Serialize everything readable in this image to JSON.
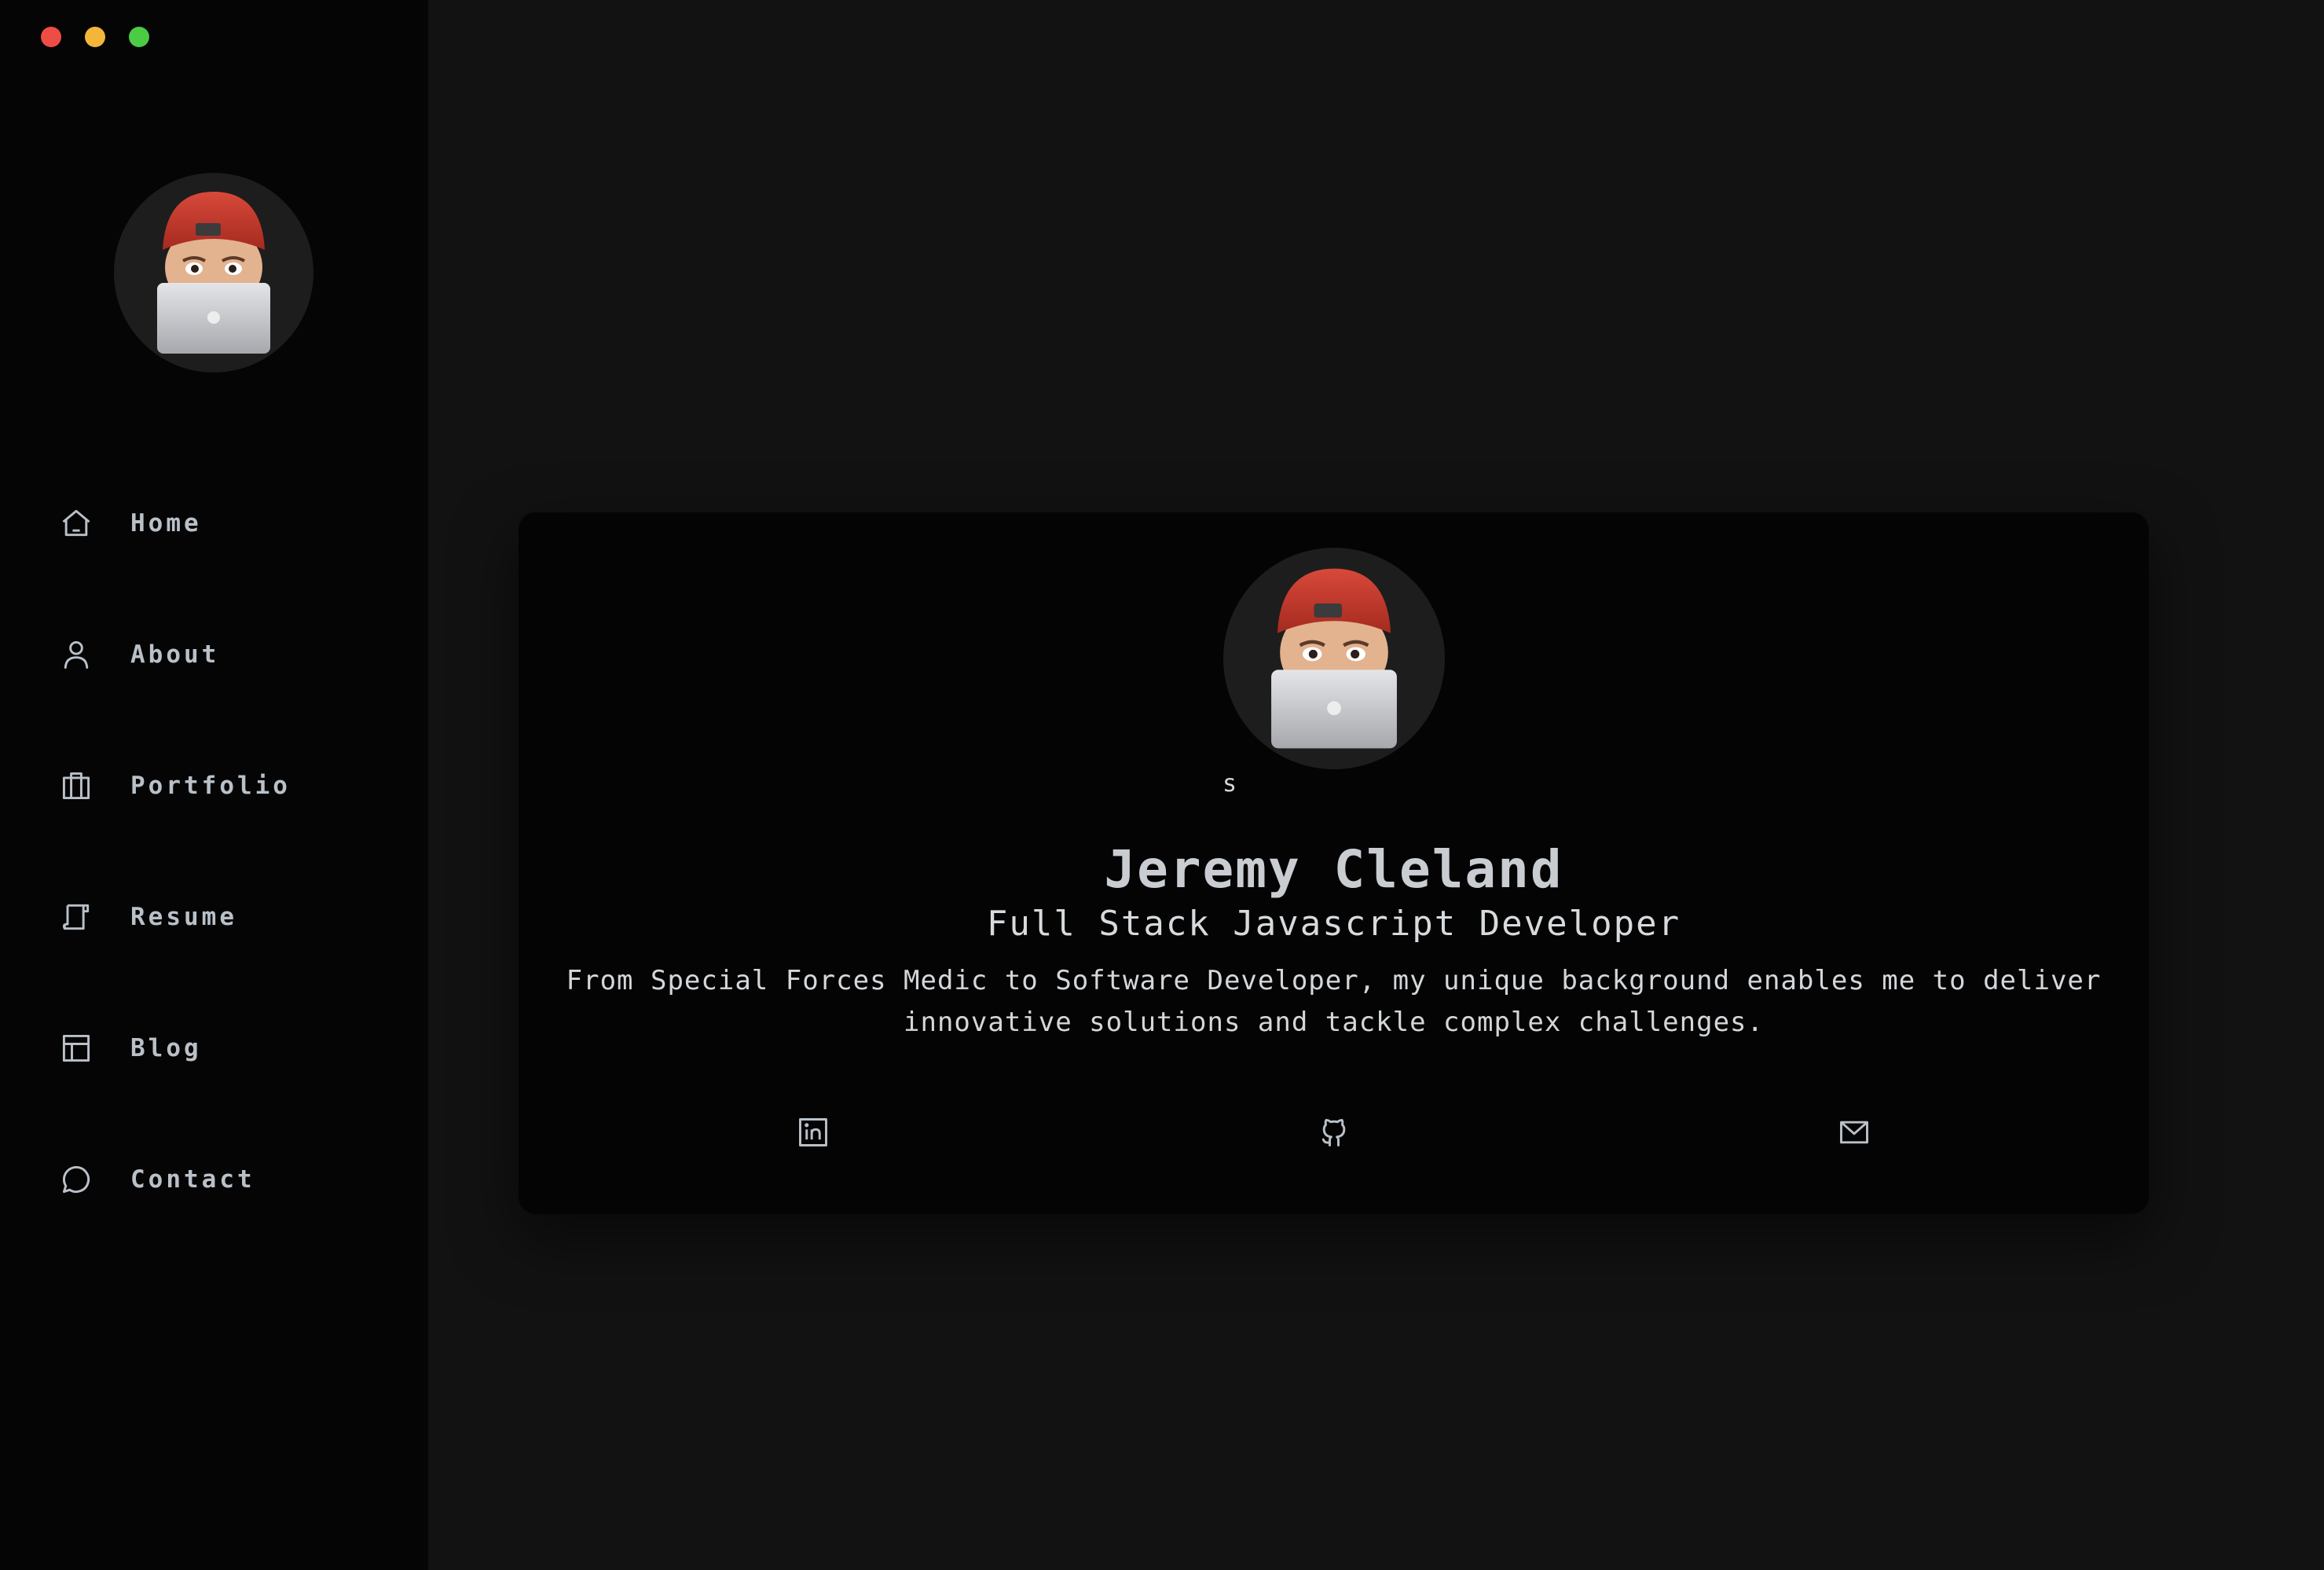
{
  "window": {
    "controls": [
      "close",
      "minimize",
      "maximize"
    ]
  },
  "sidebar": {
    "avatar_icon": "memoji-laptop-avatar",
    "items": [
      {
        "label": "Home",
        "icon": "home-icon"
      },
      {
        "label": "About",
        "icon": "user-icon"
      },
      {
        "label": "Portfolio",
        "icon": "briefcase-icon"
      },
      {
        "label": "Resume",
        "icon": "resume-icon"
      },
      {
        "label": "Blog",
        "icon": "layout-icon"
      },
      {
        "label": "Contact",
        "icon": "chat-bubble-icon"
      }
    ]
  },
  "hero": {
    "avatar_icon": "memoji-laptop-avatar",
    "stray_text": "s",
    "name": "Jeremy Cleland",
    "role": "Full Stack Javascript Developer",
    "bio": "From Special Forces Medic to Software Developer, my unique background enables me to deliver innovative solutions and tackle complex challenges.",
    "social": [
      {
        "icon": "linkedin-icon"
      },
      {
        "icon": "github-icon"
      },
      {
        "icon": "mail-icon"
      }
    ]
  },
  "colors": {
    "background": "#121212",
    "sidebar": "#050505",
    "card": "#040404",
    "text": "#c9cdd2",
    "close": "#ee4d45",
    "minimize": "#f4b63a",
    "maximize": "#4ccb44"
  }
}
